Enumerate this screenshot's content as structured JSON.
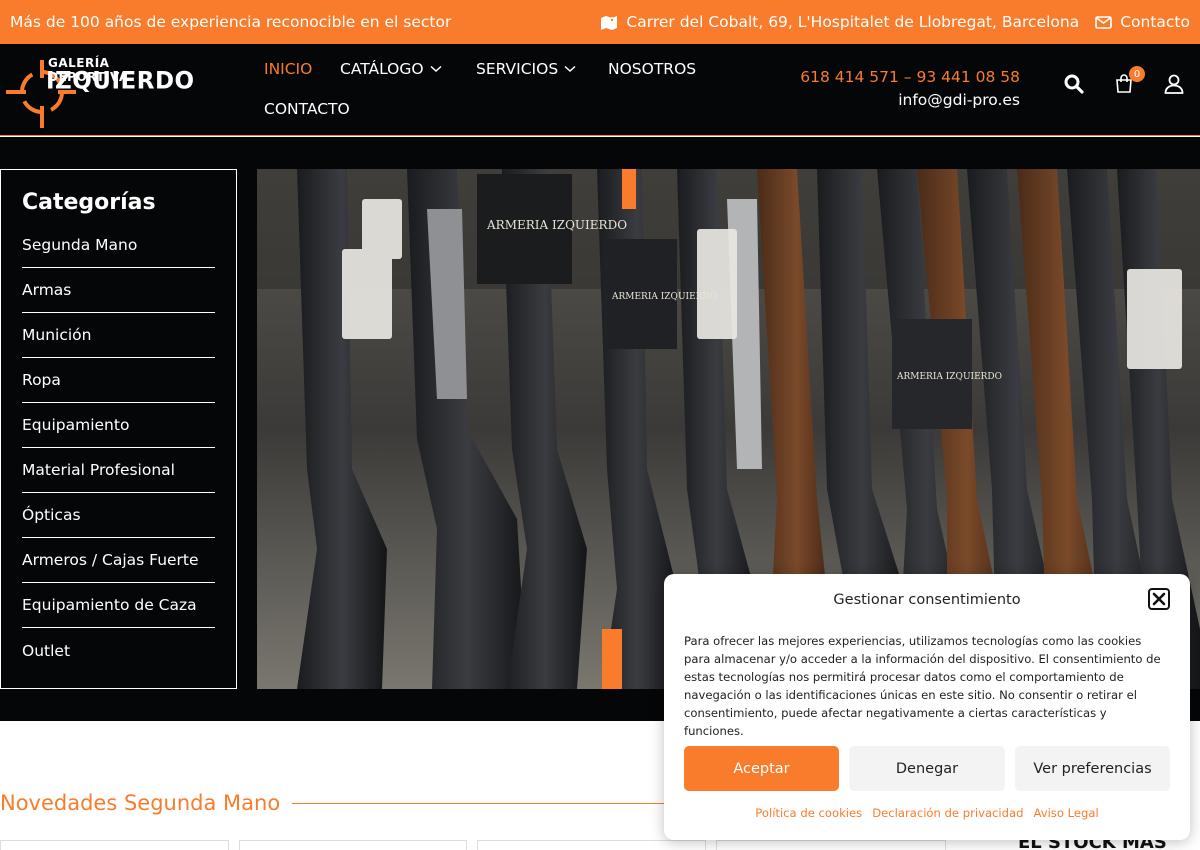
{
  "topbar": {
    "tagline": "Más de 100 años de experiencia reconocible en el sector",
    "address": "Carrer del Cobalt, 69, L'Hospitalet de Llobregat, Barcelona",
    "contact_label": "Contacto"
  },
  "logo": {
    "line1": "GALERÍA DEPORTIVA",
    "line2": "IZQUIERDO"
  },
  "nav": {
    "items": [
      {
        "label": "INICIO"
      },
      {
        "label": "CATÁLOGO"
      },
      {
        "label": "SERVICIOS"
      },
      {
        "label": "NOSOTROS"
      },
      {
        "label": "CONTACTO"
      }
    ]
  },
  "header_contact": {
    "phones": "618 414 571 – 93 441 08 58",
    "email": "info@gdi-pro.es"
  },
  "cart": {
    "count": "0"
  },
  "categories": {
    "title": "Categorías",
    "items": [
      "Segunda Mano",
      "Armas",
      "Munición",
      "Ropa",
      "Equipamiento",
      "Material Profesional",
      "Ópticas",
      "Armeros / Cajas Fuerte",
      "Equipamiento de Caza",
      "Outlet"
    ]
  },
  "hero_tags": {
    "tag1": "ARMERIA IZQUIERDO",
    "tag2": "ARMERIA IZQUIERDO",
    "tag3": "ARMERIA IZQUIERDO"
  },
  "novedades": {
    "title": "Novedades Segunda Mano"
  },
  "stock_text": "EL STOCK MÁS",
  "cookie": {
    "title": "Gestionar consentimiento",
    "body": "Para ofrecer las mejores experiencias, utilizamos tecnologías como las cookies para almacenar y/o acceder a la información del dispositivo. El consentimiento de estas tecnologías nos permitirá procesar datos como el comportamiento de navegación o las identificaciones únicas en este sitio. No consentir o retirar el consentimiento, puede afectar negativamente a ciertas características y funciones.",
    "accept": "Aceptar",
    "deny": "Denegar",
    "prefs": "Ver preferencias",
    "links": [
      "Política de cookies",
      "Declaración de privacidad",
      "Aviso Legal"
    ]
  },
  "colors": {
    "accent": "#f97c2c",
    "dark": "#050608"
  }
}
